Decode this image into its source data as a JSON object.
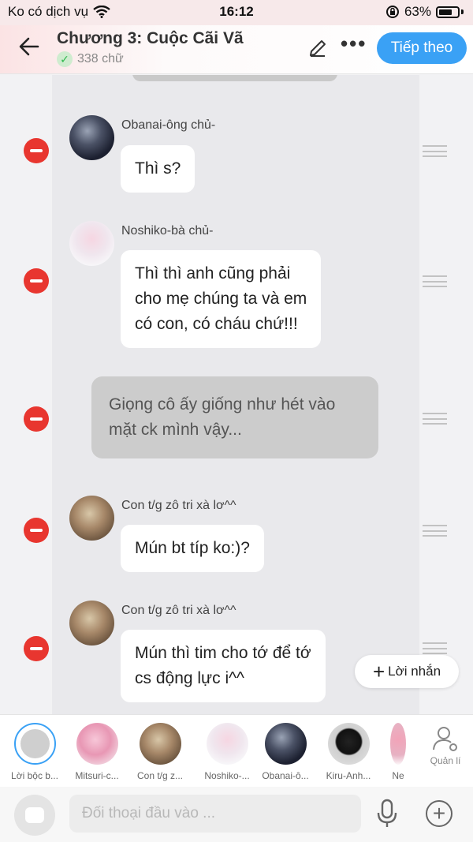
{
  "status_bar": {
    "carrier": "Ko có dịch vụ",
    "time": "16:12",
    "battery": "63%"
  },
  "header": {
    "title": "Chương 3: Cuộc Cãi Vã",
    "word_count": "338 chữ",
    "next_label": "Tiếp theo"
  },
  "messages": [
    {
      "name": "Obanai-ông chủ-",
      "text": "Thì s?"
    },
    {
      "name": "Noshiko-bà chủ-",
      "lines": [
        "Thì thì anh cũng phải",
        "cho mẹ chúng ta và em",
        "có con, có cháu chứ!!!"
      ]
    },
    {
      "narration_lines": [
        "Giọng cô ấy giống như hét vào",
        "mặt ck mình vậy..."
      ]
    },
    {
      "name": "Con t/g zô tri xà lơ^^",
      "text": "Mún bt típ ko:)?"
    },
    {
      "name": "Con t/g zô tri xà lơ^^",
      "lines": [
        "Mún thì tim cho tớ để tớ",
        "cs động lực i^^"
      ]
    }
  ],
  "note_button": "Lời nhắn",
  "characters": [
    {
      "label": "Lời bộc b..."
    },
    {
      "label": "Mitsuri-c..."
    },
    {
      "label": "Con t/g z..."
    },
    {
      "label": "Noshiko-..."
    },
    {
      "label": "Obanai-ô..."
    },
    {
      "label": "Kiru-Anh..."
    },
    {
      "label": "Ne"
    }
  ],
  "manage_label": "Quản lí",
  "input": {
    "placeholder": "Đối thoại đầu vào ..."
  },
  "icons": [
    "wifi-icon",
    "rotation-lock-icon",
    "battery-icon",
    "back-arrow-icon",
    "pencil-icon",
    "more-icon",
    "check-icon",
    "delete-icon",
    "drag-handle-icon",
    "person-gear-icon",
    "microphone-icon",
    "add-circle-icon"
  ],
  "colors": {
    "accent": "#3aa1f5",
    "delete": "#e8362f"
  }
}
